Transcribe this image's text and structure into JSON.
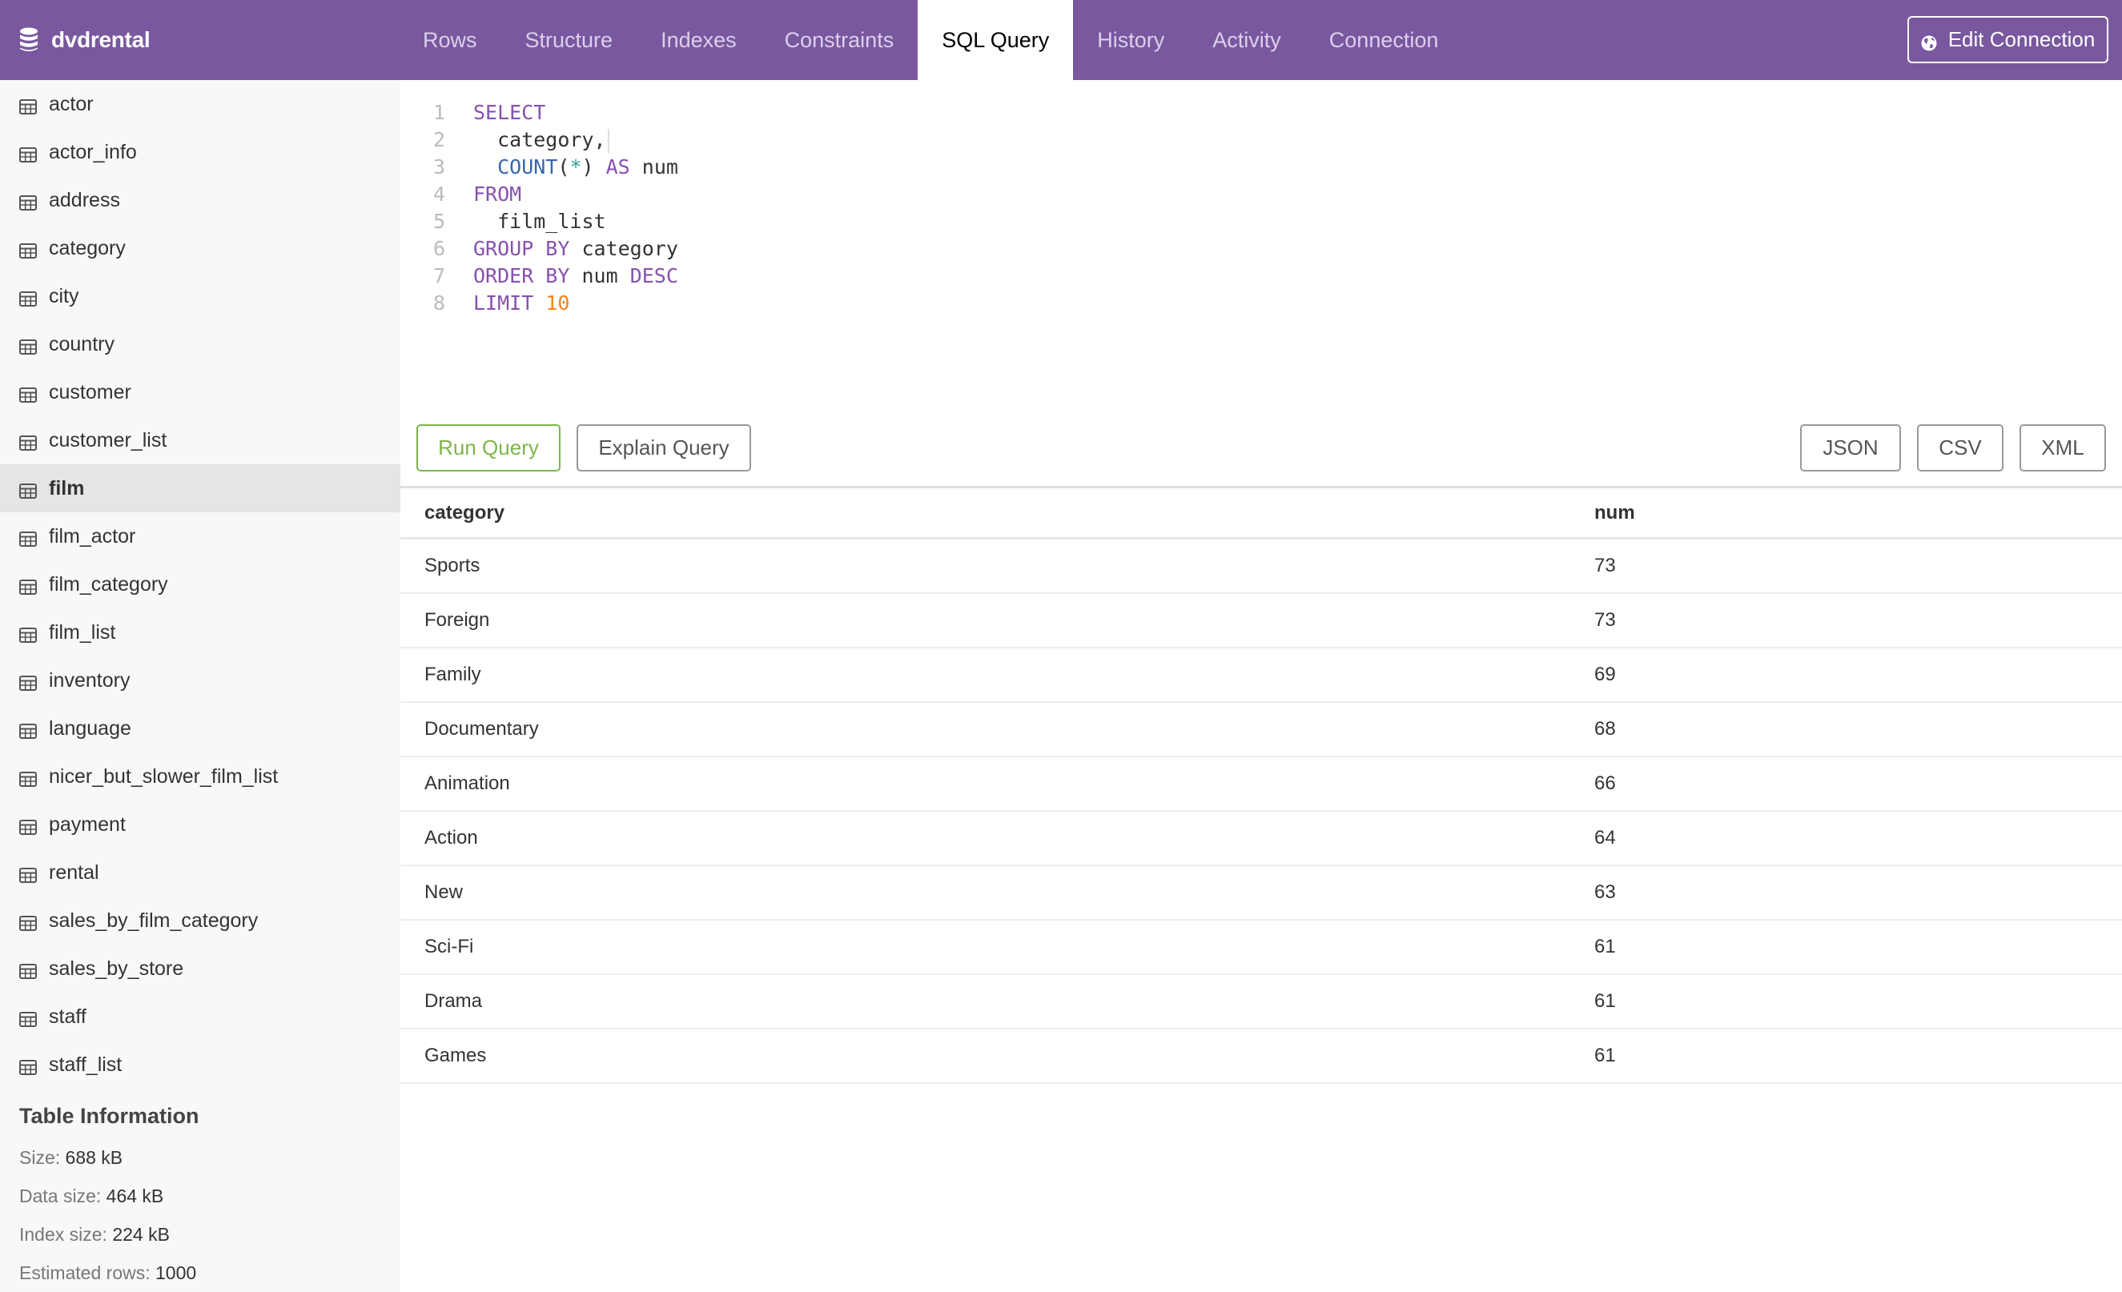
{
  "header": {
    "brand": "dvdrental",
    "brand_icon": "database-icon",
    "tabs": [
      {
        "label": "Rows",
        "active": false
      },
      {
        "label": "Structure",
        "active": false
      },
      {
        "label": "Indexes",
        "active": false
      },
      {
        "label": "Constraints",
        "active": false
      },
      {
        "label": "SQL Query",
        "active": true
      },
      {
        "label": "History",
        "active": false
      },
      {
        "label": "Activity",
        "active": false
      },
      {
        "label": "Connection",
        "active": false
      }
    ],
    "edit_connection": {
      "label": "Edit Connection",
      "icon": "globe-icon"
    }
  },
  "sidebar": {
    "items": [
      {
        "label": "actor",
        "icon": "table-icon"
      },
      {
        "label": "actor_info",
        "icon": "table-icon"
      },
      {
        "label": "address",
        "icon": "table-icon"
      },
      {
        "label": "category",
        "icon": "table-icon"
      },
      {
        "label": "city",
        "icon": "table-icon"
      },
      {
        "label": "country",
        "icon": "table-icon"
      },
      {
        "label": "customer",
        "icon": "table-icon"
      },
      {
        "label": "customer_list",
        "icon": "table-icon"
      },
      {
        "label": "film",
        "icon": "table-icon",
        "active": true
      },
      {
        "label": "film_actor",
        "icon": "table-icon"
      },
      {
        "label": "film_category",
        "icon": "table-icon"
      },
      {
        "label": "film_list",
        "icon": "table-icon"
      },
      {
        "label": "inventory",
        "icon": "table-icon"
      },
      {
        "label": "language",
        "icon": "table-icon"
      },
      {
        "label": "nicer_but_slower_film_list",
        "icon": "table-icon"
      },
      {
        "label": "payment",
        "icon": "table-icon"
      },
      {
        "label": "rental",
        "icon": "table-icon"
      },
      {
        "label": "sales_by_film_category",
        "icon": "table-icon"
      },
      {
        "label": "sales_by_store",
        "icon": "table-icon"
      },
      {
        "label": "staff",
        "icon": "table-icon"
      },
      {
        "label": "staff_list",
        "icon": "table-icon"
      }
    ],
    "table_info": {
      "title": "Table Information",
      "rows": [
        {
          "label": "Size:",
          "value": "688 kB"
        },
        {
          "label": "Data size:",
          "value": "464 kB"
        },
        {
          "label": "Index size:",
          "value": "224 kB"
        },
        {
          "label": "Estimated rows:",
          "value": "1000"
        }
      ]
    }
  },
  "editor": {
    "lines": [
      [
        {
          "t": "SELECT",
          "c": "kw"
        }
      ],
      [
        {
          "t": "  category,",
          "c": ""
        }
      ],
      [
        {
          "t": "  ",
          "c": ""
        },
        {
          "t": "COUNT",
          "c": "fn"
        },
        {
          "t": "(",
          "c": ""
        },
        {
          "t": "*",
          "c": "op"
        },
        {
          "t": ") ",
          "c": ""
        },
        {
          "t": "AS",
          "c": "kw"
        },
        {
          "t": " num",
          "c": ""
        }
      ],
      [
        {
          "t": "FROM",
          "c": "kw"
        }
      ],
      [
        {
          "t": "  film_list",
          "c": ""
        }
      ],
      [
        {
          "t": "GROUP BY",
          "c": "kw"
        },
        {
          "t": " category",
          "c": ""
        }
      ],
      [
        {
          "t": "ORDER BY",
          "c": "kw"
        },
        {
          "t": " num ",
          "c": ""
        },
        {
          "t": "DESC",
          "c": "kw"
        }
      ],
      [
        {
          "t": "LIMIT",
          "c": "kw"
        },
        {
          "t": " ",
          "c": ""
        },
        {
          "t": "10",
          "c": "num"
        }
      ]
    ],
    "cursor_line": 2
  },
  "actions": {
    "run": "Run Query",
    "explain": "Explain Query",
    "json": "JSON",
    "csv": "CSV",
    "xml": "XML"
  },
  "results": {
    "columns": [
      "category",
      "num"
    ],
    "rows": [
      [
        "Sports",
        "73"
      ],
      [
        "Foreign",
        "73"
      ],
      [
        "Family",
        "69"
      ],
      [
        "Documentary",
        "68"
      ],
      [
        "Animation",
        "66"
      ],
      [
        "Action",
        "64"
      ],
      [
        "New",
        "63"
      ],
      [
        "Sci-Fi",
        "61"
      ],
      [
        "Drama",
        "61"
      ],
      [
        "Games",
        "61"
      ]
    ]
  },
  "colors": {
    "header_bg": "#79589f",
    "run_button": "#7db54b",
    "keyword": "#8751ae",
    "function": "#3566ad",
    "number": "#f0841f"
  }
}
